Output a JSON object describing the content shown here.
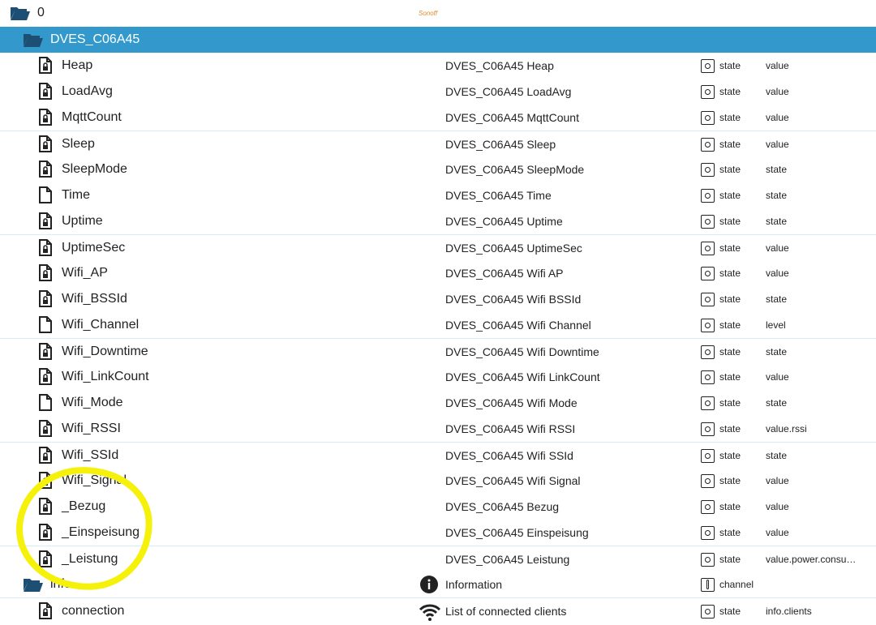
{
  "root": {
    "label": "0",
    "logo_text": "Sonoff"
  },
  "device": {
    "label": "DVES_C06A45"
  },
  "rows": [
    {
      "name": "Heap",
      "desc": "DVES_C06A45 Heap",
      "type": "state",
      "role": "value",
      "icon": "lock-file-icon"
    },
    {
      "name": "LoadAvg",
      "desc": "DVES_C06A45 LoadAvg",
      "type": "state",
      "role": "value",
      "icon": "lock-file-icon"
    },
    {
      "name": "MqttCount",
      "desc": "DVES_C06A45 MqttCount",
      "type": "state",
      "role": "value",
      "icon": "lock-file-icon"
    },
    {
      "name": "Sleep",
      "desc": "DVES_C06A45 Sleep",
      "type": "state",
      "role": "value",
      "icon": "lock-file-icon"
    },
    {
      "name": "SleepMode",
      "desc": "DVES_C06A45 SleepMode",
      "type": "state",
      "role": "state",
      "icon": "lock-file-icon"
    },
    {
      "name": "Time",
      "desc": "DVES_C06A45 Time",
      "type": "state",
      "role": "state",
      "icon": "file-icon"
    },
    {
      "name": "Uptime",
      "desc": "DVES_C06A45 Uptime",
      "type": "state",
      "role": "state",
      "icon": "lock-file-icon"
    },
    {
      "name": "UptimeSec",
      "desc": "DVES_C06A45 UptimeSec",
      "type": "state",
      "role": "value",
      "icon": "lock-file-icon"
    },
    {
      "name": "Wifi_AP",
      "desc": "DVES_C06A45 Wifi AP",
      "type": "state",
      "role": "value",
      "icon": "lock-file-icon"
    },
    {
      "name": "Wifi_BSSId",
      "desc": "DVES_C06A45 Wifi BSSId",
      "type": "state",
      "role": "state",
      "icon": "lock-file-icon"
    },
    {
      "name": "Wifi_Channel",
      "desc": "DVES_C06A45 Wifi Channel",
      "type": "state",
      "role": "level",
      "icon": "file-icon"
    },
    {
      "name": "Wifi_Downtime",
      "desc": "DVES_C06A45 Wifi Downtime",
      "type": "state",
      "role": "state",
      "icon": "lock-file-icon"
    },
    {
      "name": "Wifi_LinkCount",
      "desc": "DVES_C06A45 Wifi LinkCount",
      "type": "state",
      "role": "value",
      "icon": "lock-file-icon"
    },
    {
      "name": "Wifi_Mode",
      "desc": "DVES_C06A45 Wifi Mode",
      "type": "state",
      "role": "state",
      "icon": "file-icon"
    },
    {
      "name": "Wifi_RSSI",
      "desc": "DVES_C06A45 Wifi RSSI",
      "type": "state",
      "role": "value.rssi",
      "icon": "lock-file-icon"
    },
    {
      "name": "Wifi_SSId",
      "desc": "DVES_C06A45 Wifi SSId",
      "type": "state",
      "role": "state",
      "icon": "lock-file-icon"
    },
    {
      "name": "Wifi_Signal",
      "desc": "DVES_C06A45 Wifi Signal",
      "type": "state",
      "role": "value",
      "icon": "lock-file-icon"
    },
    {
      "name": "_Bezug",
      "desc": "DVES_C06A45 Bezug",
      "type": "state",
      "role": "value",
      "icon": "lock-file-icon"
    },
    {
      "name": "_Einspeisung",
      "desc": "DVES_C06A45 Einspeisung",
      "type": "state",
      "role": "value",
      "icon": "lock-file-icon"
    },
    {
      "name": "_Leistung",
      "desc": "DVES_C06A45 Leistung",
      "type": "state",
      "role": "value.power.consum…",
      "icon": "lock-file-icon"
    }
  ],
  "info_folder": {
    "name": "info",
    "desc": "Information",
    "type": "channel",
    "desc_icon": "info-circle-icon"
  },
  "info_rows": [
    {
      "name": "connection",
      "desc": "List of connected clients",
      "type": "state",
      "role": "info.clients",
      "desc_icon": "wifi-icon",
      "icon": "lock-file-icon"
    }
  ],
  "colors": {
    "selected_row": "#3399cc",
    "folder": "#1d4f74",
    "highlight": "#f5f10a"
  }
}
